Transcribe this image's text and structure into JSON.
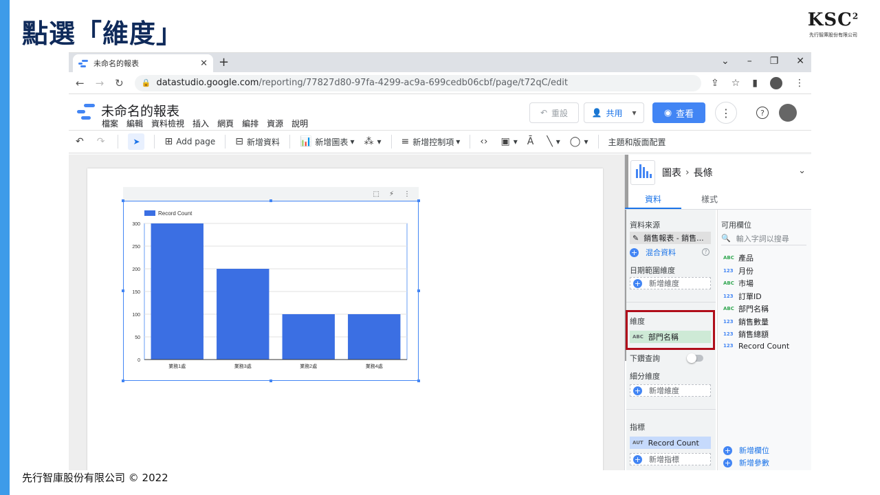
{
  "slide": {
    "title": "點選「維度」",
    "logo_text": "KSC",
    "logo_sup": "2",
    "logo_sub": "先行智庫股份有限公司",
    "footer": "先行智庫股份有限公司 © 2022",
    "accent": "#3d9be9"
  },
  "browser": {
    "tab_title": "未命名的報表",
    "tab_close": "✕",
    "new_tab": "+",
    "url_host": "datastudio.google.com",
    "url_path": "/reporting/77827d80-97fa-4299-ac9a-699cedb06cbf/page/t72qC/edit"
  },
  "app": {
    "report_name": "未命名的報表",
    "menus": [
      "檔案",
      "編輯",
      "資料檢視",
      "插入",
      "網頁",
      "編排",
      "資源",
      "說明"
    ],
    "reset_label": "重設",
    "share_label": "共用",
    "view_label": "查看",
    "brand_color": "#4285f4"
  },
  "toolbar": {
    "add_page": "Add page",
    "add_data": "新增資料",
    "add_chart": "新增圖表",
    "add_control": "新增控制項",
    "theme": "主題和版面配置"
  },
  "panel": {
    "chart_type": "圖表",
    "chart_subtype": "長條",
    "tab_data": "資料",
    "tab_style": "樣式",
    "data_source_label": "資料來源",
    "data_source_value": "銷售報表 - 銷售...",
    "blend_label": "混合資料",
    "date_dim_label": "日期範圍維度",
    "add_dimension": "新增維度",
    "dimension_label": "維度",
    "dimension_tag": "ABC",
    "dimension_value": "部門名稱",
    "drilldown_label": "下鑽查詢",
    "breakdown_label": "細分維度",
    "metric_label": "指標",
    "metric_tag": "AUT",
    "metric_value": "Record Count",
    "add_metric": "新增指標",
    "available_label": "可用欄位",
    "search_placeholder": "輸入字詞以搜尋",
    "fields": [
      {
        "tag": "ABC",
        "name": "產品"
      },
      {
        "tag": "123",
        "name": "月份"
      },
      {
        "tag": "ABC",
        "name": "市場"
      },
      {
        "tag": "123",
        "name": "訂單ID"
      },
      {
        "tag": "ABC",
        "name": "部門名稱"
      },
      {
        "tag": "123",
        "name": "銷售數量"
      },
      {
        "tag": "123",
        "name": "銷售總額"
      },
      {
        "tag": "123",
        "name": "Record Count"
      }
    ],
    "add_field": "新增欄位",
    "add_param": "新增參數",
    "highlight_color": "#b00d1a"
  },
  "chart_data": {
    "type": "bar",
    "categories": [
      "業務1處",
      "業務3處",
      "業務2處",
      "業務4處"
    ],
    "series": [
      {
        "name": "Record Count",
        "values": [
          300,
          200,
          100,
          100
        ]
      }
    ],
    "ylim": [
      0,
      300
    ],
    "yticks": [
      0,
      50,
      100,
      150,
      200,
      250,
      300
    ],
    "grid": true,
    "legend": "top-left",
    "bar_color": "#3b6fe3"
  }
}
